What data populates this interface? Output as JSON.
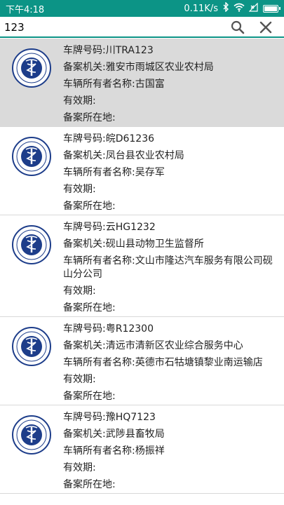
{
  "status_bar": {
    "time": "下午4:18",
    "net_speed": "0.11K/s",
    "icons": [
      "bluetooth-icon",
      "wifi-icon",
      "signal-x-icon",
      "battery-icon"
    ],
    "background": "#0c9486"
  },
  "search": {
    "value": "123",
    "icons": [
      "search-icon",
      "clear-icon"
    ]
  },
  "list": {
    "items": [
      {
        "plate": "车牌号码:川TRA123",
        "authority": "备案机关:雅安市雨城区农业农村局",
        "owner": "车辆所有者名称:古国富",
        "validity": "有效期:",
        "location": "备案所在地:",
        "selected": true
      },
      {
        "plate": "车牌号码:皖D61236",
        "authority": "备案机关:凤台县农业农村局",
        "owner": "车辆所有者名称:吴存军",
        "validity": "有效期:",
        "location": "备案所在地:"
      },
      {
        "plate": "车牌号码:云HG1232",
        "authority": "备案机关:砚山县动物卫生监督所",
        "owner": "车辆所有者名称:文山市隆达汽车服务有限公司砚山分公司",
        "validity": "有效期:",
        "location": "备案所在地:"
      },
      {
        "plate": "车牌号码:粤R12300",
        "authority": "备案机关:清远市清新区农业综合服务中心",
        "owner": "车辆所有者名称:英德市石牯塘镇黎业南运输店",
        "validity": "有效期:",
        "location": "备案所在地:"
      },
      {
        "plate": "车牌号码:豫HQ7123",
        "authority": "备案机关:武陟县畜牧局",
        "owner": "车辆所有者名称:杨振祥",
        "validity": "有效期:",
        "location": "备案所在地:"
      }
    ]
  }
}
